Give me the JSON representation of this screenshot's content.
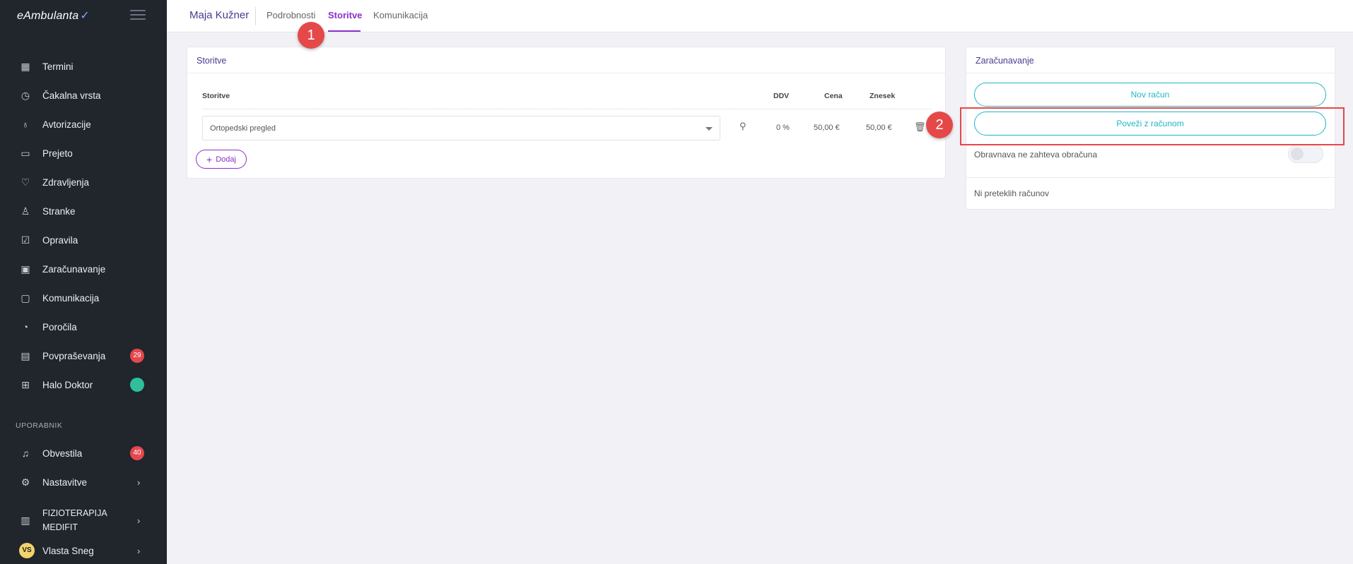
{
  "app": {
    "logo": "eAmbulanta",
    "logo_mark": "✓"
  },
  "sidebar": {
    "items": [
      {
        "label": "Termini",
        "icon": "calendar-icon"
      },
      {
        "label": "Čakalna vrsta",
        "icon": "clock-icon"
      },
      {
        "label": "Avtorizacije",
        "icon": "stethoscope-icon"
      },
      {
        "label": "Prejeto",
        "icon": "inbox-icon"
      },
      {
        "label": "Zdravljenja",
        "icon": "heart-icon"
      },
      {
        "label": "Stranke",
        "icon": "person-icon"
      },
      {
        "label": "Opravila",
        "icon": "checkbox-icon"
      },
      {
        "label": "Zaračunavanje",
        "icon": "money-icon"
      },
      {
        "label": "Komunikacija",
        "icon": "chat-icon"
      },
      {
        "label": "Poročila",
        "icon": "pie-chart-icon"
      },
      {
        "label": "Povpraševanja",
        "icon": "grid-icon",
        "badge": "29"
      },
      {
        "label": "Halo Doktor",
        "icon": "hospital-icon"
      }
    ],
    "section_user": "UPORABNIK",
    "user_items": [
      {
        "label": "Obvestila",
        "icon": "bell-icon",
        "badge": "40"
      },
      {
        "label": "Nastavitve",
        "icon": "gear-icon"
      },
      {
        "label_line1": "FIZIOTERAPIJA",
        "label_line2": "MEDIFIT",
        "icon": "clipboard-icon"
      },
      {
        "label": "Vlasta Sneg",
        "avatar": "VS"
      }
    ]
  },
  "topbar": {
    "user_name": "Maja Kužner",
    "tabs": [
      "Podrobnosti",
      "Storitve",
      "Komunikacija"
    ],
    "active_tab": "Storitve"
  },
  "services_card": {
    "title": "Storitve",
    "columns": {
      "service": "Storitve",
      "vat": "DDV",
      "price": "Cena",
      "amount": "Znesek"
    },
    "rows": [
      {
        "service": "Ortopedski pregled",
        "vat": "0 %",
        "price": "50,00 €",
        "amount": "50,00 €"
      }
    ],
    "add_label": "Dodaj"
  },
  "billing_card": {
    "title": "Zaračunavanje",
    "new_invoice": "Nov račun",
    "link_invoice": "Poveži z računom",
    "toggle_label": "Obravnava ne zahteva obračuna",
    "no_invoices": "Ni preteklih računov"
  },
  "annotations": {
    "marker1": "1",
    "marker2": "2"
  },
  "colors": {
    "accent": "#8b2fc9",
    "teal": "#1fb7c6",
    "annotation": "#e54848",
    "sidebar": "#21252c"
  }
}
